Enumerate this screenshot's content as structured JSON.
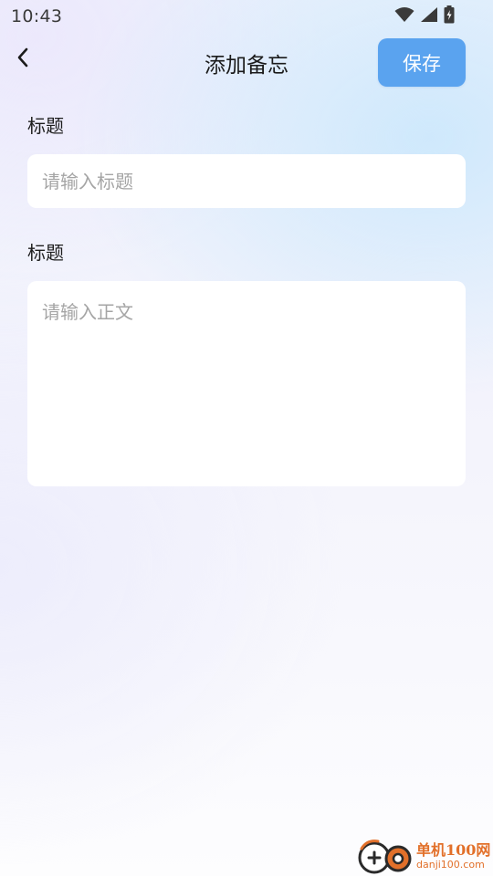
{
  "status_bar": {
    "time": "10:43",
    "icons": [
      "wifi-icon",
      "cell-signal-icon",
      "battery-charging-icon"
    ]
  },
  "header": {
    "back_icon": "chevron-left-icon",
    "title": "添加备忘",
    "save_label": "保存"
  },
  "form": {
    "title_label": "标题",
    "title_value": "",
    "title_placeholder": "请输入标题",
    "body_label": "标题",
    "body_value": "",
    "body_placeholder": "请输入正文"
  },
  "watermark": {
    "name_cn": "单机100网",
    "domain": "danji100.com"
  },
  "colors": {
    "accent": "#5aa3ef",
    "watermark_orange": "#e2702a"
  }
}
